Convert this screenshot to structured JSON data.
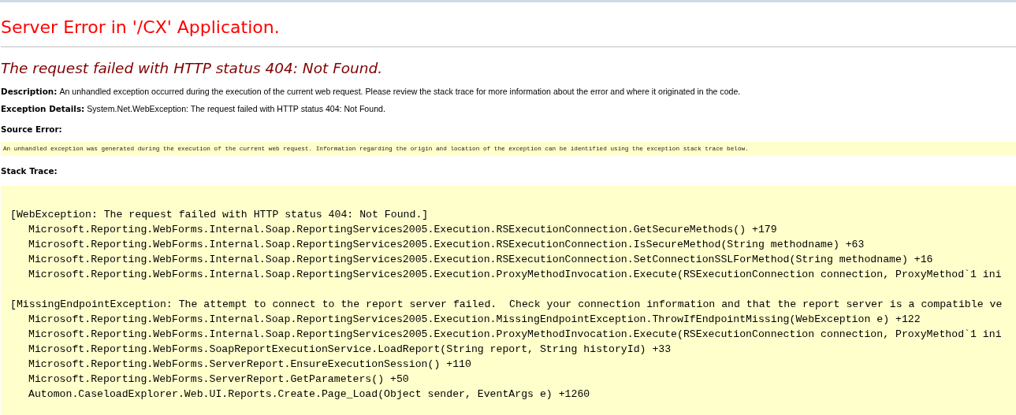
{
  "title": "Server Error in '/CX' Application.",
  "error_message": "The request failed with HTTP status 404: Not Found.",
  "details": [
    {
      "label": "Description:",
      "text": "An unhandled exception occurred during the execution of the current web request. Please review the stack trace for more information about the error and where it originated in the code."
    },
    {
      "label": "Exception Details:",
      "text": "System.Net.WebException: The request failed with HTTP status 404: Not Found."
    }
  ],
  "source_error": {
    "label": "Source Error:",
    "text": "An unhandled exception was generated during the execution of the current web request. Information regarding the origin and location of the exception can be identified using the exception stack trace below."
  },
  "stack_trace": {
    "label": "Stack Trace:",
    "blocks": [
      {
        "header": "[WebException: The request failed with HTTP status 404: Not Found.]",
        "frames": [
          "Microsoft.Reporting.WebForms.Internal.Soap.ReportingServices2005.Execution.RSExecutionConnection.GetSecureMethods() +179",
          "Microsoft.Reporting.WebForms.Internal.Soap.ReportingServices2005.Execution.RSExecutionConnection.IsSecureMethod(String methodname) +63",
          "Microsoft.Reporting.WebForms.Internal.Soap.ReportingServices2005.Execution.RSExecutionConnection.SetConnectionSSLForMethod(String methodname) +16",
          "Microsoft.Reporting.WebForms.Internal.Soap.ReportingServices2005.Execution.ProxyMethodInvocation.Execute(RSExecutionConnection connection, ProxyMethod`1 ini"
        ]
      },
      {
        "header": "[MissingEndpointException: The attempt to connect to the report server failed.  Check your connection information and that the report server is a compatible ve",
        "frames": [
          "Microsoft.Reporting.WebForms.Internal.Soap.ReportingServices2005.Execution.MissingEndpointException.ThrowIfEndpointMissing(WebException e) +122",
          "Microsoft.Reporting.WebForms.Internal.Soap.ReportingServices2005.Execution.ProxyMethodInvocation.Execute(RSExecutionConnection connection, ProxyMethod`1 ini",
          "Microsoft.Reporting.WebForms.SoapReportExecutionService.LoadReport(String report, String historyId) +33",
          "Microsoft.Reporting.WebForms.ServerReport.EnsureExecutionSession() +110",
          "Microsoft.Reporting.WebForms.ServerReport.GetParameters() +50",
          "Automon.CaseloadExplorer.Web.UI.Reports.Create.Page_Load(Object sender, EventArgs e) +1260"
        ]
      }
    ]
  }
}
